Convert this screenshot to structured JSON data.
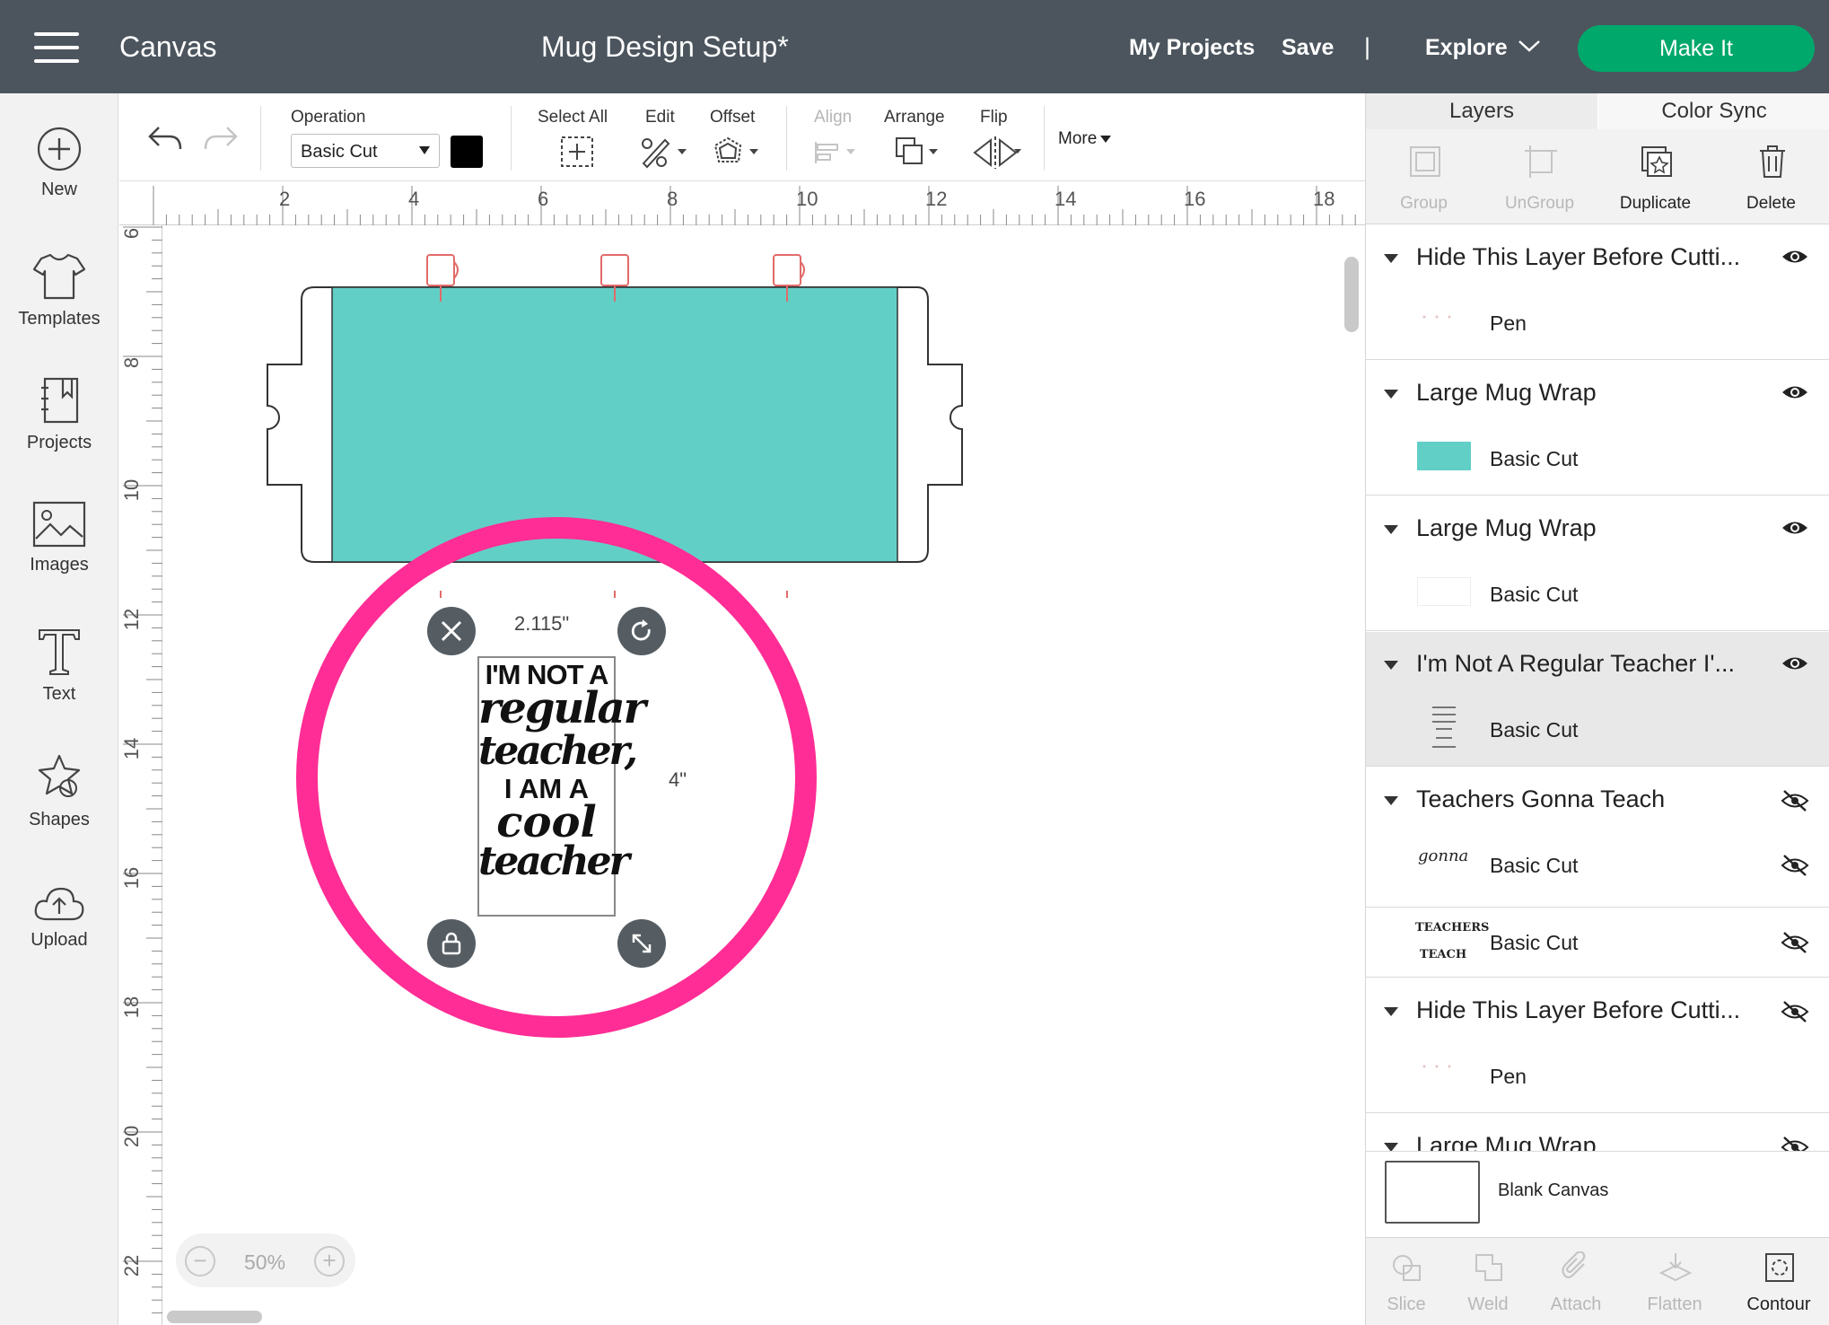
{
  "topbar": {
    "app_title": "Canvas",
    "doc_title": "Mug Design Setup*",
    "my_projects": "My Projects",
    "save": "Save",
    "separator": "|",
    "explore": "Explore",
    "make_it": "Make It",
    "make_it_color": "#00a86b"
  },
  "sidebar": {
    "items": [
      {
        "label": "New",
        "icon": "plus-circle-icon"
      },
      {
        "label": "Templates",
        "icon": "tshirt-icon"
      },
      {
        "label": "Projects",
        "icon": "notebook-icon"
      },
      {
        "label": "Images",
        "icon": "image-icon"
      },
      {
        "label": "Text",
        "icon": "text-t-icon"
      },
      {
        "label": "Shapes",
        "icon": "shapes-icon"
      },
      {
        "label": "Upload",
        "icon": "cloud-upload-icon"
      }
    ]
  },
  "toolbar": {
    "operation_label": "Operation",
    "operation_value": "Basic Cut",
    "select_all": "Select All",
    "edit": "Edit",
    "offset": "Offset",
    "align": "Align",
    "arrange": "Arrange",
    "flip": "Flip",
    "more": "More"
  },
  "ruler": {
    "top": [
      "2",
      "4",
      "6",
      "8",
      "10",
      "12",
      "14",
      "16",
      "18"
    ],
    "left": [
      "6",
      "8",
      "10",
      "12",
      "14",
      "16",
      "18",
      "20",
      "22"
    ]
  },
  "canvas": {
    "selection_width": "2.115\"",
    "selection_height": "4\"",
    "design_lines": [
      "I'M NOT A",
      "regular",
      "teacher,",
      "I AM A",
      "cool",
      "teacher"
    ],
    "mug_wrap_color": "#62cfc6",
    "highlight_color": "#ff2d95",
    "zoom": "50%",
    "zoom_minus": "−",
    "zoom_plus": "+"
  },
  "panel": {
    "tabs": {
      "layers": "Layers",
      "color_sync": "Color Sync"
    },
    "actions": {
      "group": "Group",
      "ungroup": "UnGroup",
      "duplicate": "Duplicate",
      "delete": "Delete"
    },
    "layers": [
      {
        "name": "Hide This Layer Before Cutti...",
        "visible": true,
        "rows": [
          {
            "label": "Pen",
            "thumb": "dots"
          }
        ]
      },
      {
        "name": "Large Mug Wrap",
        "visible": true,
        "rows": [
          {
            "label": "Basic Cut",
            "thumb": "teal"
          }
        ]
      },
      {
        "name": "Large Mug Wrap",
        "visible": true,
        "rows": [
          {
            "label": "Basic Cut",
            "thumb": "white"
          }
        ]
      },
      {
        "name": "I'm Not A Regular Teacher I'...",
        "visible": true,
        "selected": true,
        "rows": [
          {
            "label": "Basic Cut",
            "thumb": "text"
          }
        ]
      },
      {
        "name": "Teachers Gonna Teach",
        "visible": false,
        "rows": [
          {
            "label": "Basic Cut",
            "thumb": "gonna"
          },
          {
            "label": "Basic Cut",
            "thumb": "teachers"
          }
        ]
      },
      {
        "name": "Hide This Layer Before Cutti...",
        "visible": false,
        "rows": [
          {
            "label": "Pen",
            "thumb": "dots"
          }
        ]
      },
      {
        "name": "Large Mug Wrap",
        "visible": false,
        "rows": []
      }
    ],
    "thumb_text": {
      "gonna": "gonna",
      "teachers_line1": "TEACHERS",
      "teachers_line2": "TEACH"
    },
    "blank_canvas": "Blank Canvas",
    "bottom_actions": {
      "slice": "Slice",
      "weld": "Weld",
      "attach": "Attach",
      "flatten": "Flatten",
      "contour": "Contour"
    }
  }
}
